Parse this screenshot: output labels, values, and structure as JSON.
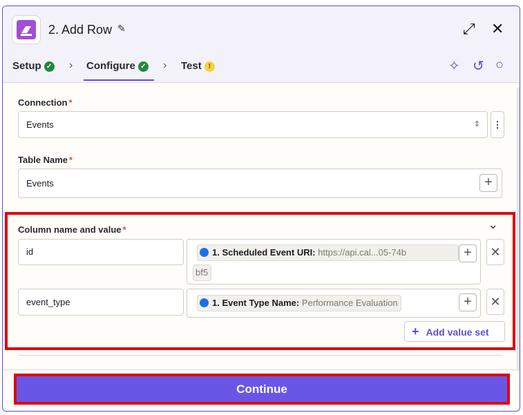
{
  "header": {
    "title": "2. Add Row",
    "edit_icon": "pencil-icon",
    "expand_icon": "expand-icon",
    "close_icon": "close-icon"
  },
  "tabs": [
    {
      "label": "Setup",
      "status": "complete"
    },
    {
      "label": "Configure",
      "status": "complete"
    },
    {
      "label": "Test",
      "status": "warning"
    }
  ],
  "toolbar_icons": [
    "sparkle-icon",
    "undo-icon",
    "search-icon"
  ],
  "fields": {
    "connection": {
      "label": "Connection",
      "required_mark": "*",
      "value": "Events"
    },
    "table_name": {
      "label": "Table Name",
      "required_mark": "*",
      "value": "Events"
    },
    "column_values": {
      "label": "Column name and value",
      "required_mark": "*",
      "rows": [
        {
          "name": "id",
          "pill_label": "1. Scheduled Event URI:",
          "pill_value": "https://api.cal...05-74b",
          "continuation": "bf5"
        },
        {
          "name": "event_type",
          "pill_label": "1. Event Type Name:",
          "pill_value": "Performance Evaluation"
        }
      ],
      "add_value_set": "Add value set"
    }
  },
  "continue_label": "Continue",
  "colors": {
    "accent": "#5b4fd6",
    "continue": "#6857e6",
    "highlight": "#e0040b",
    "app_icon": "#a14fd3"
  }
}
